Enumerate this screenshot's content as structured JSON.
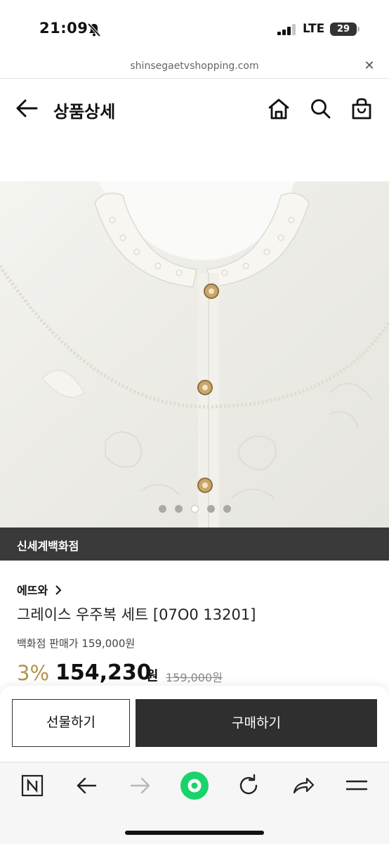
{
  "status_bar": {
    "time": "21:09",
    "network": "LTE",
    "battery": "29"
  },
  "browser": {
    "url": "shinsegaetvshopping.com"
  },
  "header": {
    "title": "상품상세"
  },
  "gallery": {
    "page_count": 5,
    "active_index": 2
  },
  "store": {
    "name": "신세계백화점"
  },
  "product": {
    "brand": "에뜨와",
    "name": "그레이스 우주복 세트 [07O0 13201]",
    "dept_price_label": "백화점 판매가 159,000원",
    "discount": "3%",
    "price": "154,230",
    "currency": "원",
    "original_price": "159,000원"
  },
  "actions": {
    "gift": "선물하기",
    "buy": "구매하기"
  },
  "colors": {
    "accent": "#b5934d",
    "dark": "#2f2f2f",
    "refresh_green": "#19d36b"
  }
}
